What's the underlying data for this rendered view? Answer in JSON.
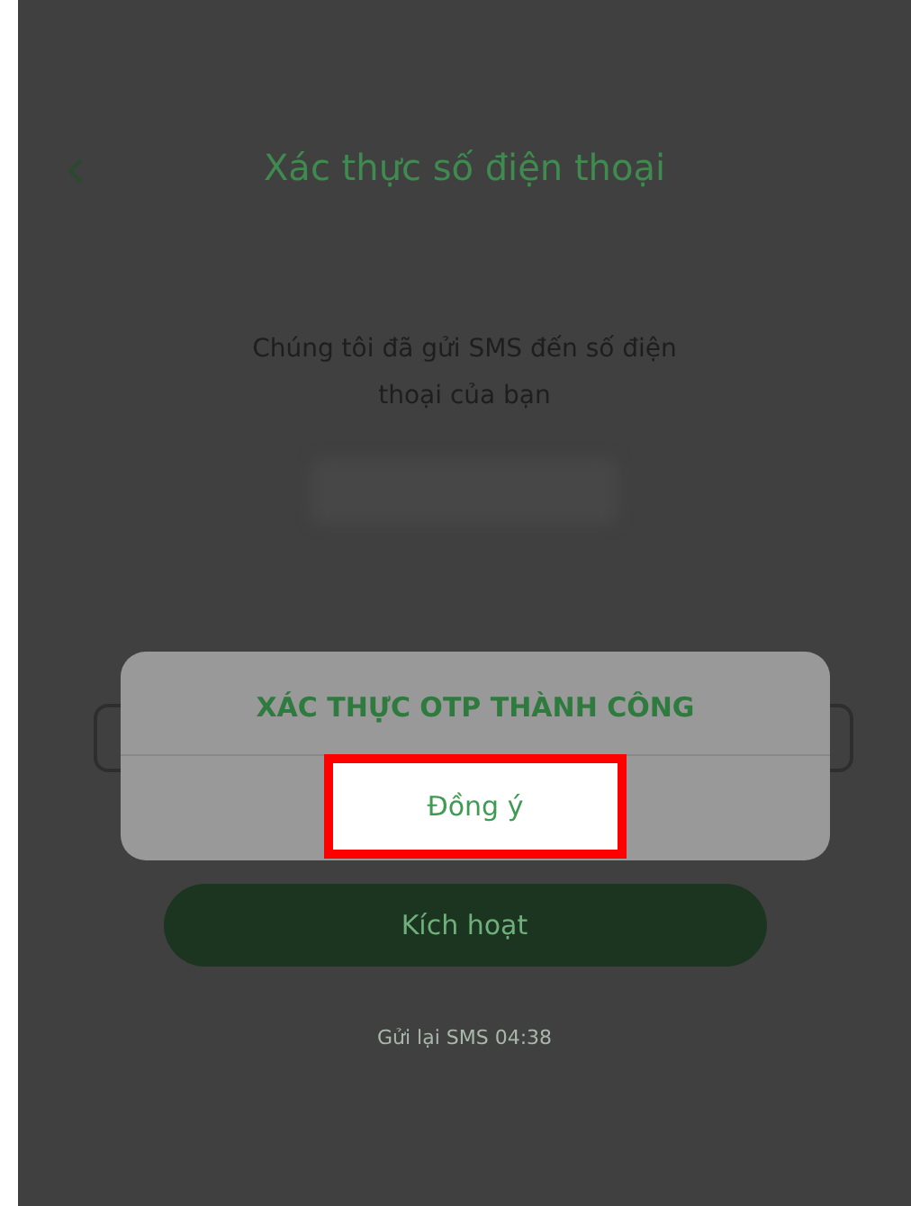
{
  "header": {
    "title": "Xác thực số điện thoại"
  },
  "message": "Chúng tôi đã gửi SMS đến số điện thoại của bạn",
  "activate_button": "Kích hoạt",
  "resend": "Gửi lại SMS 04:38",
  "dialog": {
    "title": "XÁC THỰC OTP THÀNH CÔNG",
    "confirm_button": "Đồng ý",
    "highlighted": true
  }
}
